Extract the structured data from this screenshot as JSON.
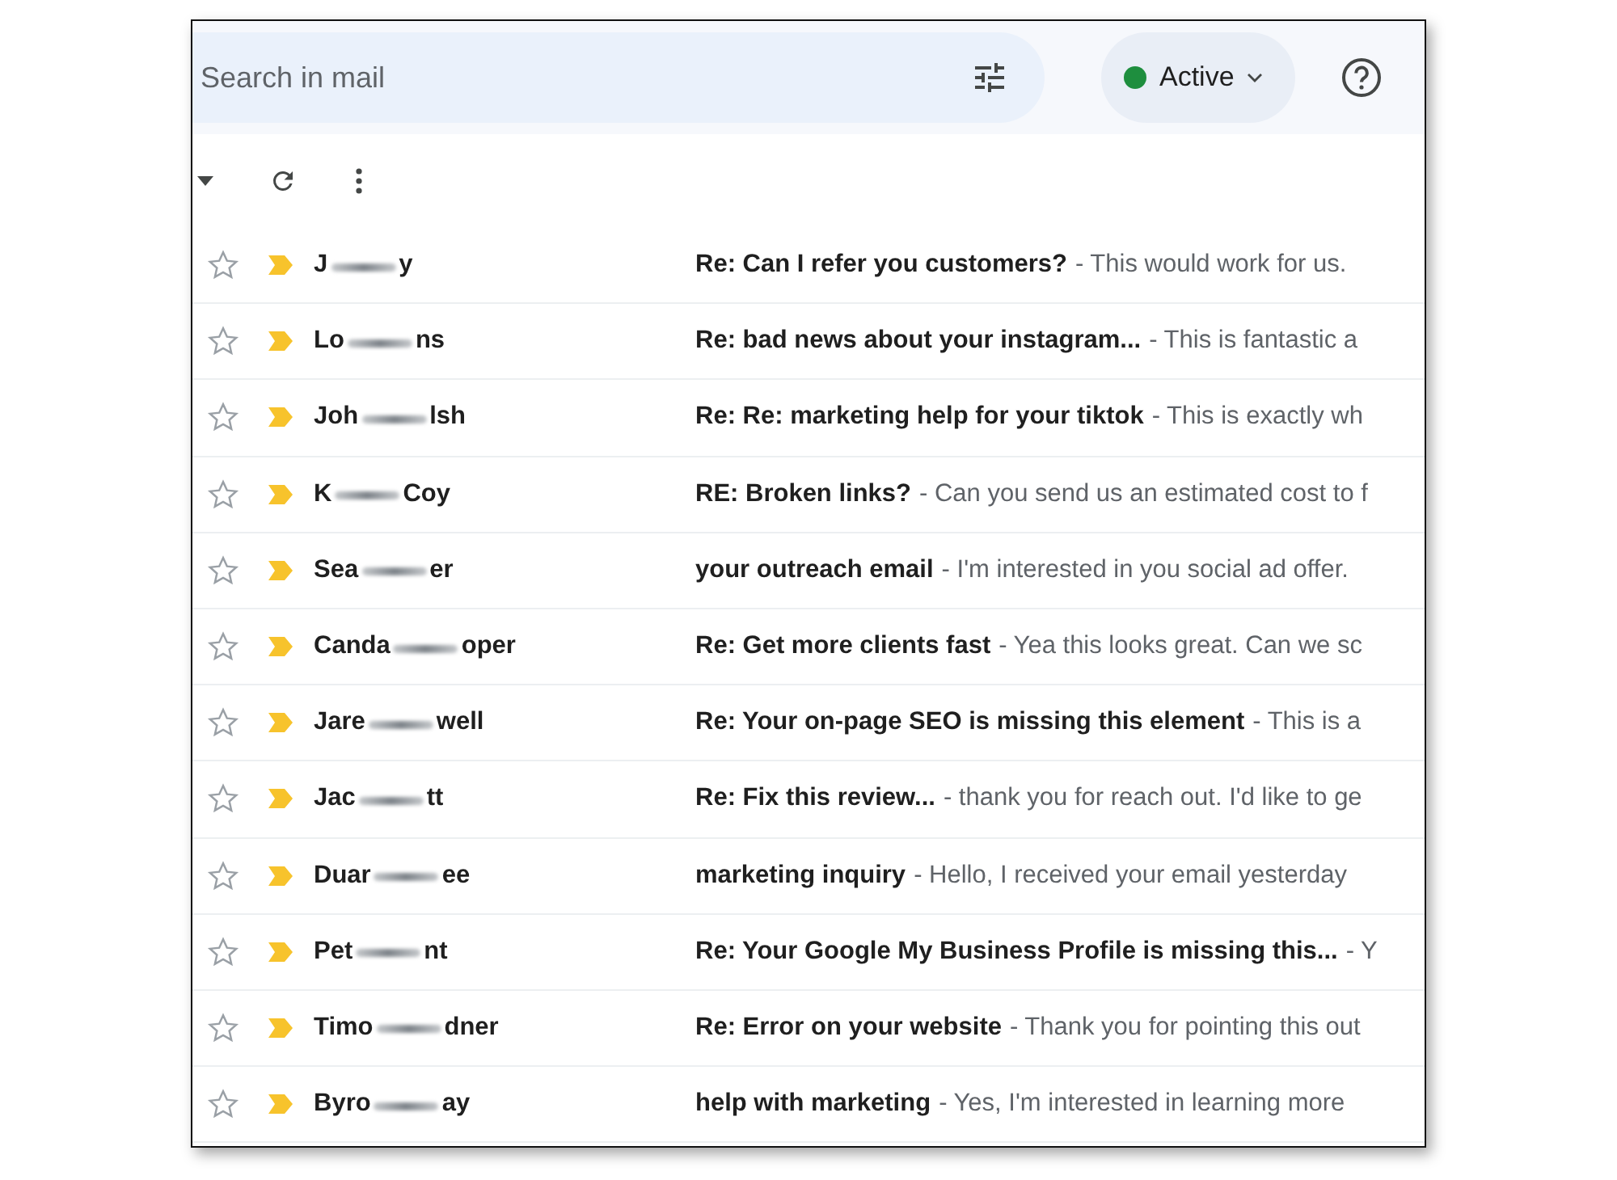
{
  "search": {
    "placeholder": "Search in mail"
  },
  "status": {
    "label": "Active",
    "color": "#1e8e3e"
  },
  "messages": [
    {
      "sender_start": "J",
      "sender_end": "y",
      "subject": "Re: Can I refer you customers?",
      "snippet": "- This would work for us.",
      "starred": false,
      "important": true
    },
    {
      "sender_start": "Lo",
      "sender_end": "ns",
      "subject": "Re: bad news about your instagram...",
      "snippet": "- This is fantastic a",
      "starred": false,
      "important": true
    },
    {
      "sender_start": "Joh",
      "sender_end": "lsh",
      "subject": "Re: Re: marketing help for your tiktok",
      "snippet": "- This is exactly wh",
      "starred": false,
      "important": true
    },
    {
      "sender_start": "K",
      "sender_end": "Coy",
      "subject": "RE: Broken links?",
      "snippet": "- Can you send us an estimated cost to f",
      "starred": false,
      "important": true
    },
    {
      "sender_start": "Sea",
      "sender_end": "er",
      "subject": "your outreach email",
      "snippet": "- I'm interested in you social ad offer.",
      "starred": false,
      "important": true
    },
    {
      "sender_start": "Canda",
      "sender_end": "oper",
      "subject": "Re: Get more clients fast",
      "snippet": "- Yea this looks great. Can we sc",
      "starred": false,
      "important": true
    },
    {
      "sender_start": "Jare",
      "sender_end": "well",
      "subject": "Re: Your on-page SEO is missing this element",
      "snippet": "- This is a",
      "starred": false,
      "important": true
    },
    {
      "sender_start": "Jac",
      "sender_end": "tt",
      "subject": "Re: Fix this review...",
      "snippet": "- thank you for reach out. I'd like to ge",
      "starred": false,
      "important": true
    },
    {
      "sender_start": "Duar",
      "sender_end": "ee",
      "subject": "marketing inquiry",
      "snippet": "- Hello, I received your email yesterday",
      "starred": false,
      "important": true
    },
    {
      "sender_start": "Pet",
      "sender_end": "nt",
      "subject": "Re: Your Google My Business Profile is missing this...",
      "snippet": "- Y",
      "starred": false,
      "important": true
    },
    {
      "sender_start": "Timo",
      "sender_end": "dner",
      "subject": "Re: Error on your website",
      "snippet": "- Thank you for pointing this out",
      "starred": false,
      "important": true
    },
    {
      "sender_start": "Byro",
      "sender_end": "ay",
      "subject": "help with marketing",
      "snippet": "- Yes, I'm interested in learning more",
      "starred": false,
      "important": true
    }
  ]
}
